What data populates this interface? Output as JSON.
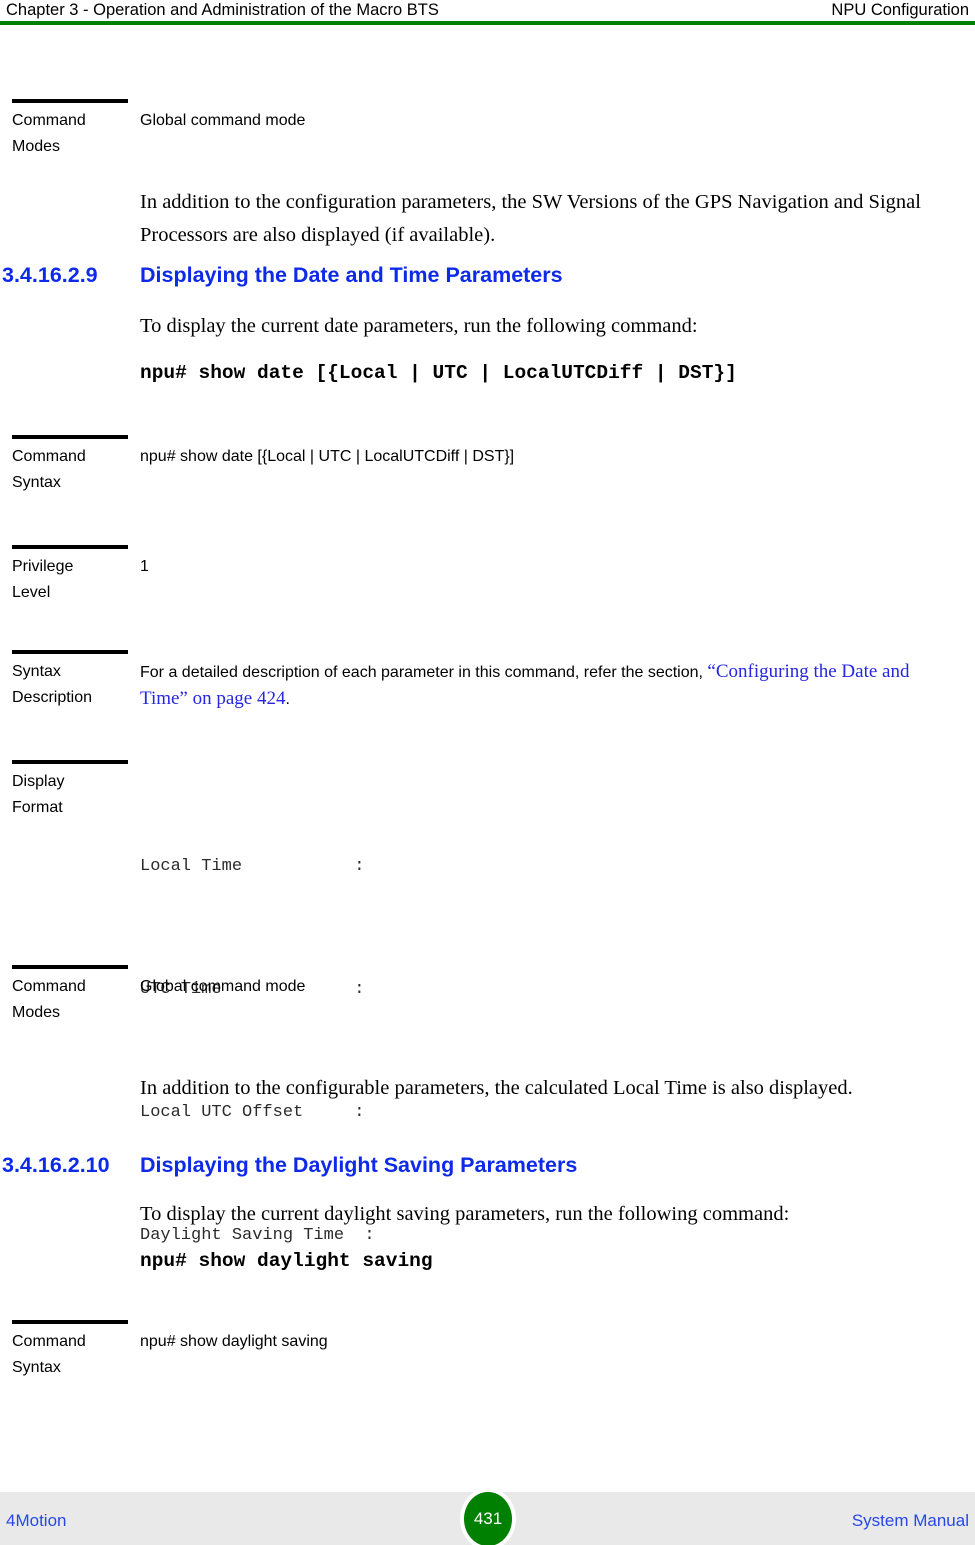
{
  "header": {
    "left": "Chapter 3 - Operation and Administration of the Macro BTS",
    "right": "NPU Configuration",
    "rule_color": "#008000"
  },
  "blocks": {
    "gps_command_modes": {
      "label_line1": "Command",
      "label_line2": "Modes",
      "value": "Global command mode"
    },
    "gps_note": "In addition to the configuration parameters, the SW Versions of the GPS Navigation and Signal Processors are also displayed (if available).",
    "section_date": {
      "number": "3.4.16.2.9",
      "title": "Displaying the Date and Time Parameters",
      "intro": "To display the current date parameters, run the following command:",
      "command": "npu# show date [{Local | UTC | LocalUTCDiff | DST}]"
    },
    "date_command_syntax": {
      "label_line1": "Command",
      "label_line2": "Syntax",
      "value": "npu# show date [{Local | UTC | LocalUTCDiff | DST}]"
    },
    "date_privilege_level": {
      "label_line1": "Privilege",
      "label_line2": "Level",
      "value": "1"
    },
    "date_syntax_description": {
      "label_line1": "Syntax",
      "label_line2": "Description",
      "value_prefix": "For a detailed description of each parameter in this command, refer the section, ",
      "value_link": "“Configuring the Date and Time” on page 424",
      "value_suffix": "."
    },
    "date_display_format": {
      "label_line1": "Display",
      "label_line2": "Format",
      "lines": [
        "Local Time           :",
        "UTC Time             :",
        "Local UTC Offset     :",
        "Daylight Saving Time  :"
      ]
    },
    "date_command_modes": {
      "label_line1": "Command",
      "label_line2": "Modes",
      "value": "Global command mode"
    },
    "date_note": "In addition to the configurable parameters, the calculated Local Time is also displayed.",
    "section_daylight": {
      "number": "3.4.16.2.10",
      "title": "Displaying the Daylight Saving Parameters",
      "intro": "To display the current daylight saving parameters, run the following command:",
      "command": "npu# show daylight saving"
    },
    "daylight_command_syntax": {
      "label_line1": "Command",
      "label_line2": "Syntax",
      "value": "npu# show daylight saving"
    }
  },
  "footer": {
    "left": "4Motion",
    "page": "431",
    "right": "System Manual",
    "page_badge_color": "#008000",
    "link_color": "#2747e8"
  }
}
